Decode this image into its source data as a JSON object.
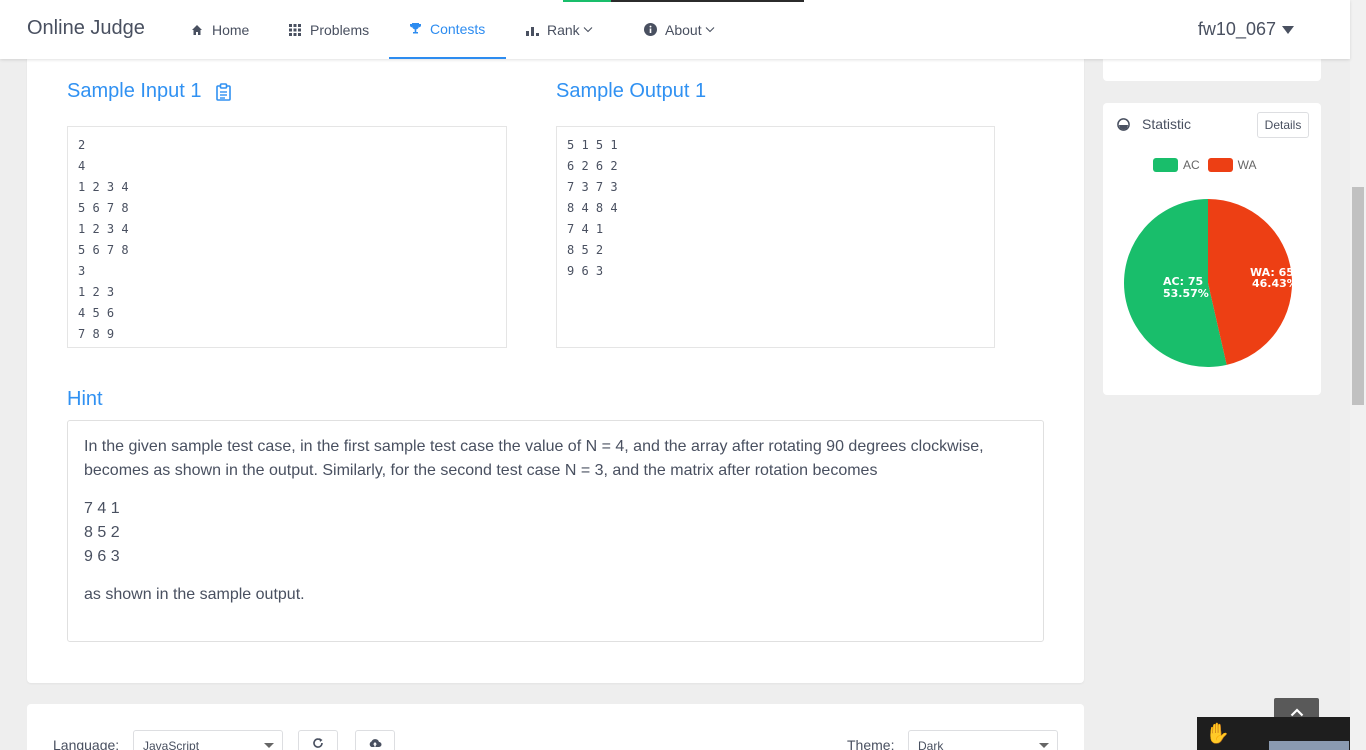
{
  "header": {
    "brand": "Online Judge",
    "nav": [
      {
        "label": "Home",
        "icon": "home-icon"
      },
      {
        "label": "Problems",
        "icon": "grid-icon"
      },
      {
        "label": "Contests",
        "icon": "trophy-icon",
        "active": true
      },
      {
        "label": "Rank",
        "icon": "bar-chart-icon"
      },
      {
        "label": "About",
        "icon": "info-icon"
      }
    ],
    "user": "fw10_067"
  },
  "problem": {
    "sample_input_title": "Sample Input 1",
    "sample_output_title": "Sample Output 1",
    "sample_input": "2\n4\n1 2 3 4\n5 6 7 8\n1 2 3 4\n5 6 7 8\n3\n1 2 3\n4 5 6\n7 8 9",
    "sample_output": "5 1 5 1\n6 2 6 2\n7 3 7 3\n8 4 8 4\n7 4 1\n8 5 2\n9 6 3",
    "hint_title": "Hint",
    "hint_paragraph": "In the given sample test case, in the first sample test case the value of N = 4, and the array after rotating 90 degrees clockwise, becomes as shown in the output. Similarly, for the second test case N = 3, and the matrix after rotation becomes",
    "hint_matrix": [
      "7 4 1",
      "8 5 2",
      "9 6 3"
    ],
    "hint_closing": "as shown in the sample output."
  },
  "statistic": {
    "title": "Statistic",
    "details_label": "Details",
    "colors": {
      "ac": "#19be6b",
      "wa": "#ed3f14"
    },
    "ac_text": "AC: 75",
    "ac_pct_text": "53.57%",
    "wa_text": "WA: 65",
    "wa_pct_text": "46.43%"
  },
  "chart_data": {
    "type": "pie",
    "labels": [
      "AC",
      "WA"
    ],
    "values": [
      75,
      65
    ],
    "percentages": [
      53.57,
      46.43
    ],
    "legend": "top"
  },
  "editor_bar": {
    "language_label": "Language:",
    "language_value": "JavaScript",
    "theme_label": "Theme:",
    "theme_value": "Dark"
  }
}
